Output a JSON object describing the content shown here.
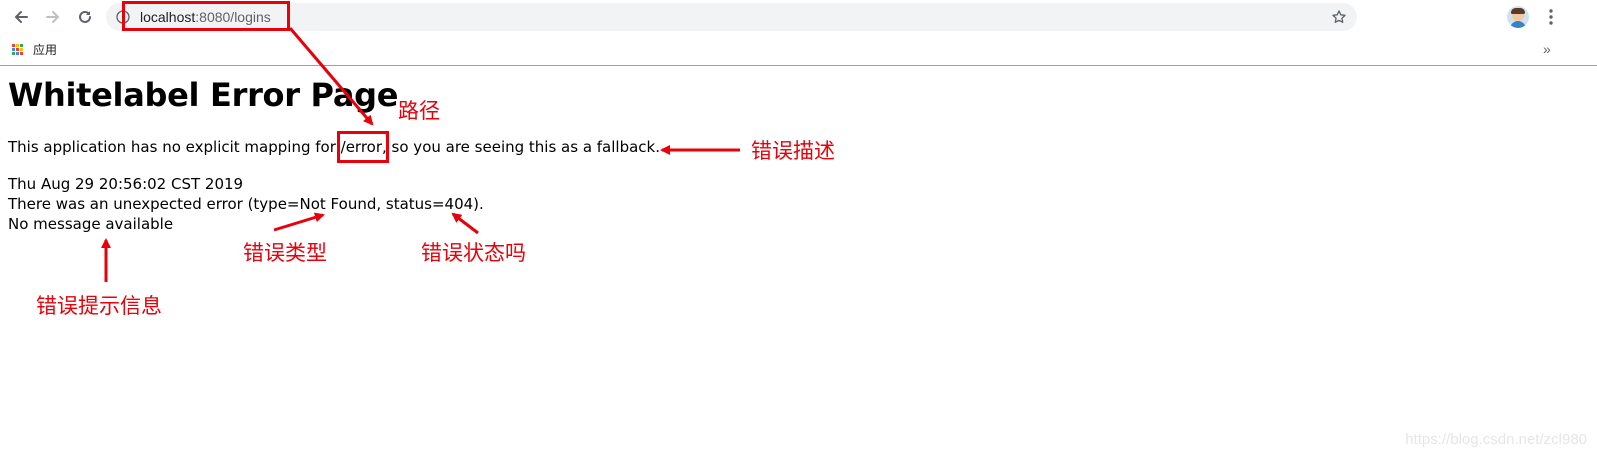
{
  "browser": {
    "url_host": "localhost",
    "url_rest": ":8080/logins",
    "bookmarks": {
      "apps_label": "应用"
    },
    "apps_colors": [
      "#ea4335",
      "#fbbc05",
      "#34a853",
      "#4285f4",
      "#ea4335",
      "#fbbc05",
      "#34a853",
      "#4285f4",
      "#ea4335"
    ]
  },
  "page": {
    "title": "Whitelabel Error Page",
    "mapping_prefix": "This application has no explicit mapping for ",
    "mapping_path": "/error",
    "mapping_suffix": ", so you are seeing this as a fallback.",
    "timestamp": "Thu Aug 29 20:56:02 CST 2019",
    "error_line": "There was an unexpected error (type=Not Found, status=404).",
    "message": "No message available"
  },
  "annotations": {
    "path": "路径",
    "error_description": "错误描述",
    "error_type": "错误类型",
    "error_status": "错误状态吗",
    "error_message": "错误提示信息",
    "color": "#e8000b"
  },
  "watermark": "https://blog.csdn.net/zcl980"
}
